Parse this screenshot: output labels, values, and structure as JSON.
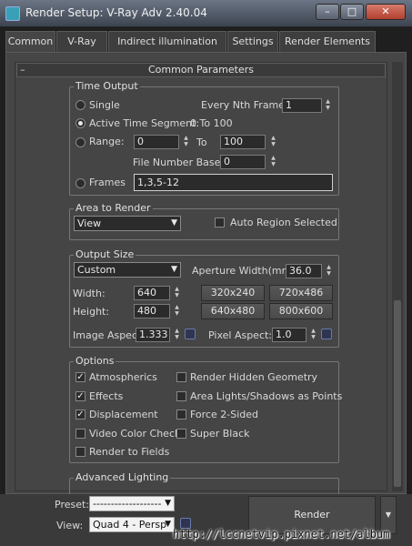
{
  "window": {
    "title": "Render Setup: V-Ray Adv 2.40.04",
    "min": "–",
    "max": "□",
    "close": "✕"
  },
  "tabs": [
    {
      "label": "Common",
      "active": true
    },
    {
      "label": "V-Ray"
    },
    {
      "label": "Indirect illumination"
    },
    {
      "label": "Settings"
    },
    {
      "label": "Render Elements"
    }
  ],
  "rollout": {
    "minus": "–",
    "title": "Common Parameters"
  },
  "time_output": {
    "title": "Time Output",
    "single": "Single",
    "every_nth_label": "Every Nth Frame:",
    "every_nth_value": "1",
    "active_segment": "Active Time Segment:",
    "active_segment_value": "0 To 100",
    "range": "Range:",
    "range_from": "0",
    "range_to_label": "To",
    "range_to": "100",
    "file_number_base_label": "File Number Base:",
    "file_number_base": "0",
    "frames": "Frames",
    "frames_value": "1,3,5-12",
    "selected": "active_segment"
  },
  "area_to_render": {
    "title": "Area to Render",
    "value": "View",
    "auto_region": "Auto Region Selected"
  },
  "output_size": {
    "title": "Output Size",
    "preset": "Custom",
    "aperture_label": "Aperture Width(mm):",
    "aperture_value": "36.0",
    "width_label": "Width:",
    "width": "640",
    "height_label": "Height:",
    "height": "480",
    "presets": [
      "320x240",
      "720x486",
      "640x480",
      "800x600"
    ],
    "image_aspect_label": "Image Aspect:",
    "image_aspect": "1.333",
    "pixel_aspect_label": "Pixel Aspect:",
    "pixel_aspect": "1.0"
  },
  "options": {
    "title": "Options",
    "items": [
      {
        "label": "Atmospherics",
        "checked": true
      },
      {
        "label": "Render Hidden Geometry",
        "checked": false
      },
      {
        "label": "Effects",
        "checked": true
      },
      {
        "label": "Area Lights/Shadows as Points",
        "checked": false
      },
      {
        "label": "Displacement",
        "checked": true
      },
      {
        "label": "Force 2-Sided",
        "checked": false
      },
      {
        "label": "Video Color Check",
        "checked": false
      },
      {
        "label": "Super Black",
        "checked": false
      },
      {
        "label": "Render to Fields",
        "checked": false
      }
    ]
  },
  "advanced_lighting": {
    "title": "Advanced Lighting"
  },
  "bottom": {
    "preset_label": "Preset:",
    "preset_value": "-------------------",
    "view_label": "View:",
    "view_value": "Quad 4 - Persp",
    "render_label": "Render",
    "menu_arrow": "▼"
  },
  "watermark": "http://lccnetvip.pixnet.net/album",
  "icons": {
    "app": "3dsmax-logo-icon",
    "lock": "lock-icon"
  },
  "colors": {
    "background": "#464646",
    "field": "#2b2b2b",
    "titlebar": "#4e5664",
    "close": "#c45a4a"
  }
}
